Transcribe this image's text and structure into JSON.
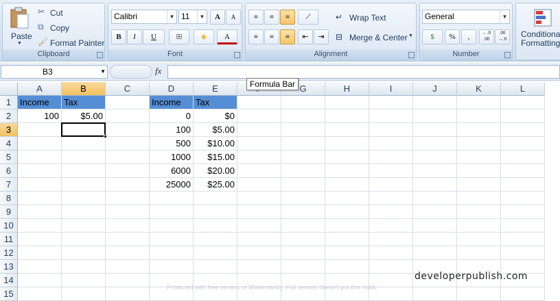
{
  "ribbon": {
    "clipboard": {
      "label": "Clipboard",
      "paste": "Paste",
      "cut": "Cut",
      "copy": "Copy",
      "format_painter": "Format Painter"
    },
    "font": {
      "label": "Font",
      "font_name": "Calibri",
      "font_size": "11",
      "bold": "B",
      "italic": "I",
      "underline": "U",
      "grow": "A",
      "shrink": "A",
      "font_color": "A"
    },
    "alignment": {
      "label": "Alignment",
      "wrap_text": "Wrap Text",
      "merge_center": "Merge & Center"
    },
    "number": {
      "label": "Number",
      "format": "General",
      "percent": "%",
      "comma": ",",
      "inc_decimal": "←.0\n.00",
      "dec_decimal": ".00\n→.0"
    },
    "styles": {
      "conditional_formatting": "Conditional\nFormatting"
    }
  },
  "formula_bar": {
    "name_box": "B3",
    "fx": "fx",
    "value": "",
    "tooltip": "Formula Bar"
  },
  "columns": [
    "A",
    "B",
    "C",
    "D",
    "E",
    "F",
    "G",
    "H",
    "I",
    "J",
    "K",
    "L"
  ],
  "selected_column": "B",
  "rows": [
    "1",
    "2",
    "3",
    "4",
    "5",
    "6",
    "7",
    "8",
    "9",
    "10",
    "11",
    "12",
    "13",
    "14",
    "15"
  ],
  "selected_row": "3",
  "cells": {
    "A1": "Income",
    "B1": "Tax",
    "A2": "100",
    "B2": "$5.00",
    "D1": "Income",
    "E1": "Tax",
    "D2": "0",
    "E2": "$0",
    "D3": "100",
    "E3": "$5.00",
    "D4": "500",
    "E4": "$10.00",
    "D5": "1000",
    "E5": "$15.00",
    "D6": "6000",
    "E6": "$20.00",
    "D7": "25000",
    "E7": "$25.00"
  },
  "header_fill": "#558ed5",
  "watermark": "developerpublish.com",
  "faint_watermark": "Protected with free version of Watermarkly. Full version doesn't put this mark."
}
